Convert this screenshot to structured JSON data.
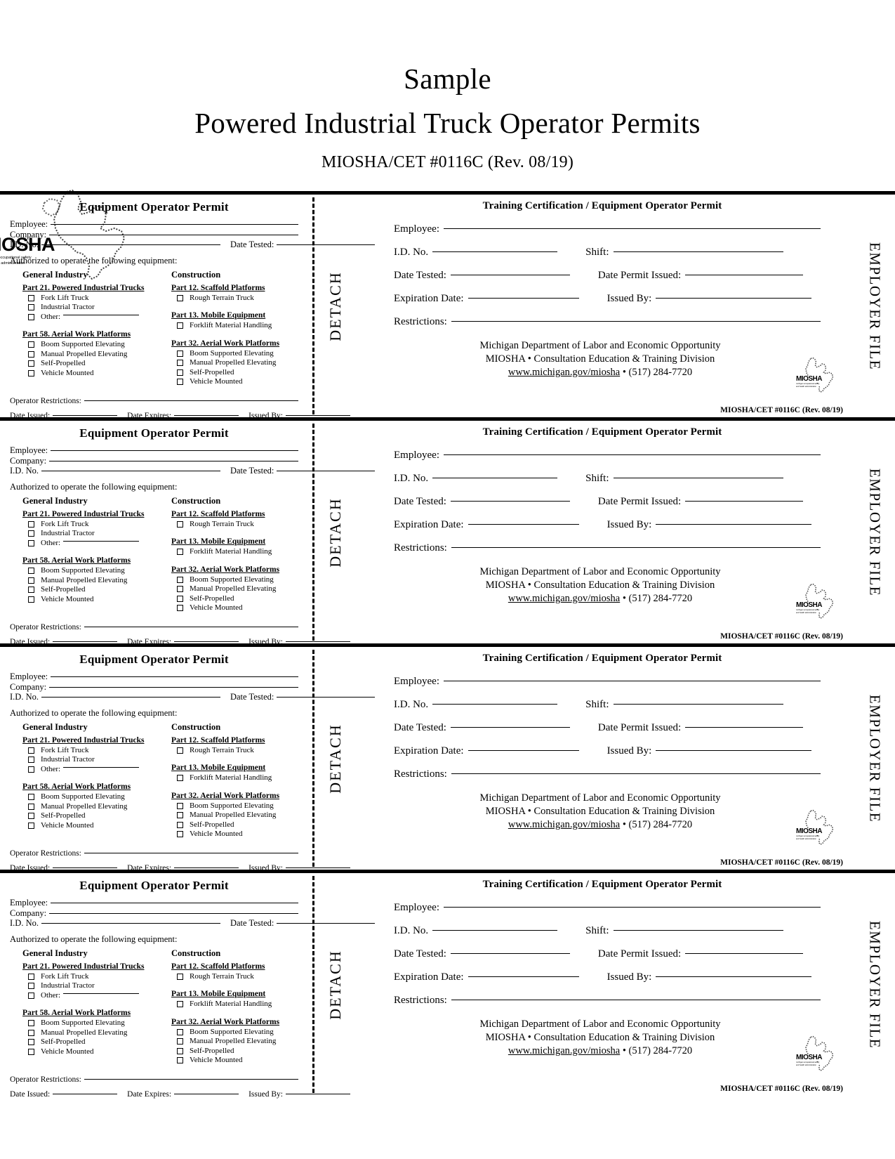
{
  "header": {
    "title_line1": "Sample",
    "title_line2": "Powered Industrial Truck Operator Permits",
    "subtitle": "MIOSHA/CET #0116C (Rev. 08/19)",
    "logo": {
      "wordmark": "MIOSHA",
      "subline1": "michigan occupational safety",
      "subline2": "and health administration"
    }
  },
  "stub": {
    "title": "Equipment Operator Permit",
    "employee_label": "Employee:",
    "company_label": "Company:",
    "id_no_label": "I.D. No.",
    "date_tested_label": "Date Tested:",
    "authorized_label": "Authorized to operate the following equipment:",
    "general_industry_heading": "General Industry",
    "construction_heading": "Construction",
    "gi_part21_heading": "Part 21. Powered Industrial Trucks",
    "gi_part21_items": [
      "Fork Lift Truck",
      "Industrial Tractor",
      "Other:"
    ],
    "gi_part58_heading": "Part 58. Aerial Work Platforms",
    "gi_part58_items": [
      "Boom Supported Elevating",
      "Manual Propelled Elevating",
      "Self-Propelled",
      "Vehicle Mounted"
    ],
    "con_part12_heading": "Part 12. Scaffold Platforms",
    "con_part12_items": [
      "Rough Terrain Truck"
    ],
    "con_part13_heading": "Part 13. Mobile Equipment",
    "con_part13_items": [
      "Forklift Material Handling"
    ],
    "con_part32_heading": "Part 32. Aerial Work Platforms",
    "con_part32_items": [
      "Boom Supported Elevating",
      "Manual Propelled Elevating",
      "Self-Propelled",
      "Vehicle Mounted"
    ],
    "operator_restrictions_label": "Operator Restrictions:",
    "date_issued_label": "Date Issued:",
    "date_expires_label": "Date Expires:",
    "issued_by_label": "Issued By:"
  },
  "detach_label": "DETACH",
  "employer_file_label": "EMPLOYER FILE",
  "card": {
    "title": "Training Certification / Equipment Operator Permit",
    "employee_label": "Employee:",
    "id_no_label": "I.D. No.",
    "shift_label": "Shift:",
    "date_tested_label": "Date Tested:",
    "date_permit_issued_label": "Date Permit Issued:",
    "expiration_date_label": "Expiration Date:",
    "issued_by_label": "Issued By:",
    "restrictions_label": "Restrictions:",
    "agency_line1": "Michigan Department of Labor and Economic Opportunity",
    "agency_line2": "MIOSHA • Consultation Education & Training Division",
    "agency_website": "www.michigan.gov/miosha",
    "agency_phone": "• (517) 284-7720",
    "revision": "MIOSHA/CET #0116C  (Rev. 08/19)"
  },
  "sections_count": 4
}
